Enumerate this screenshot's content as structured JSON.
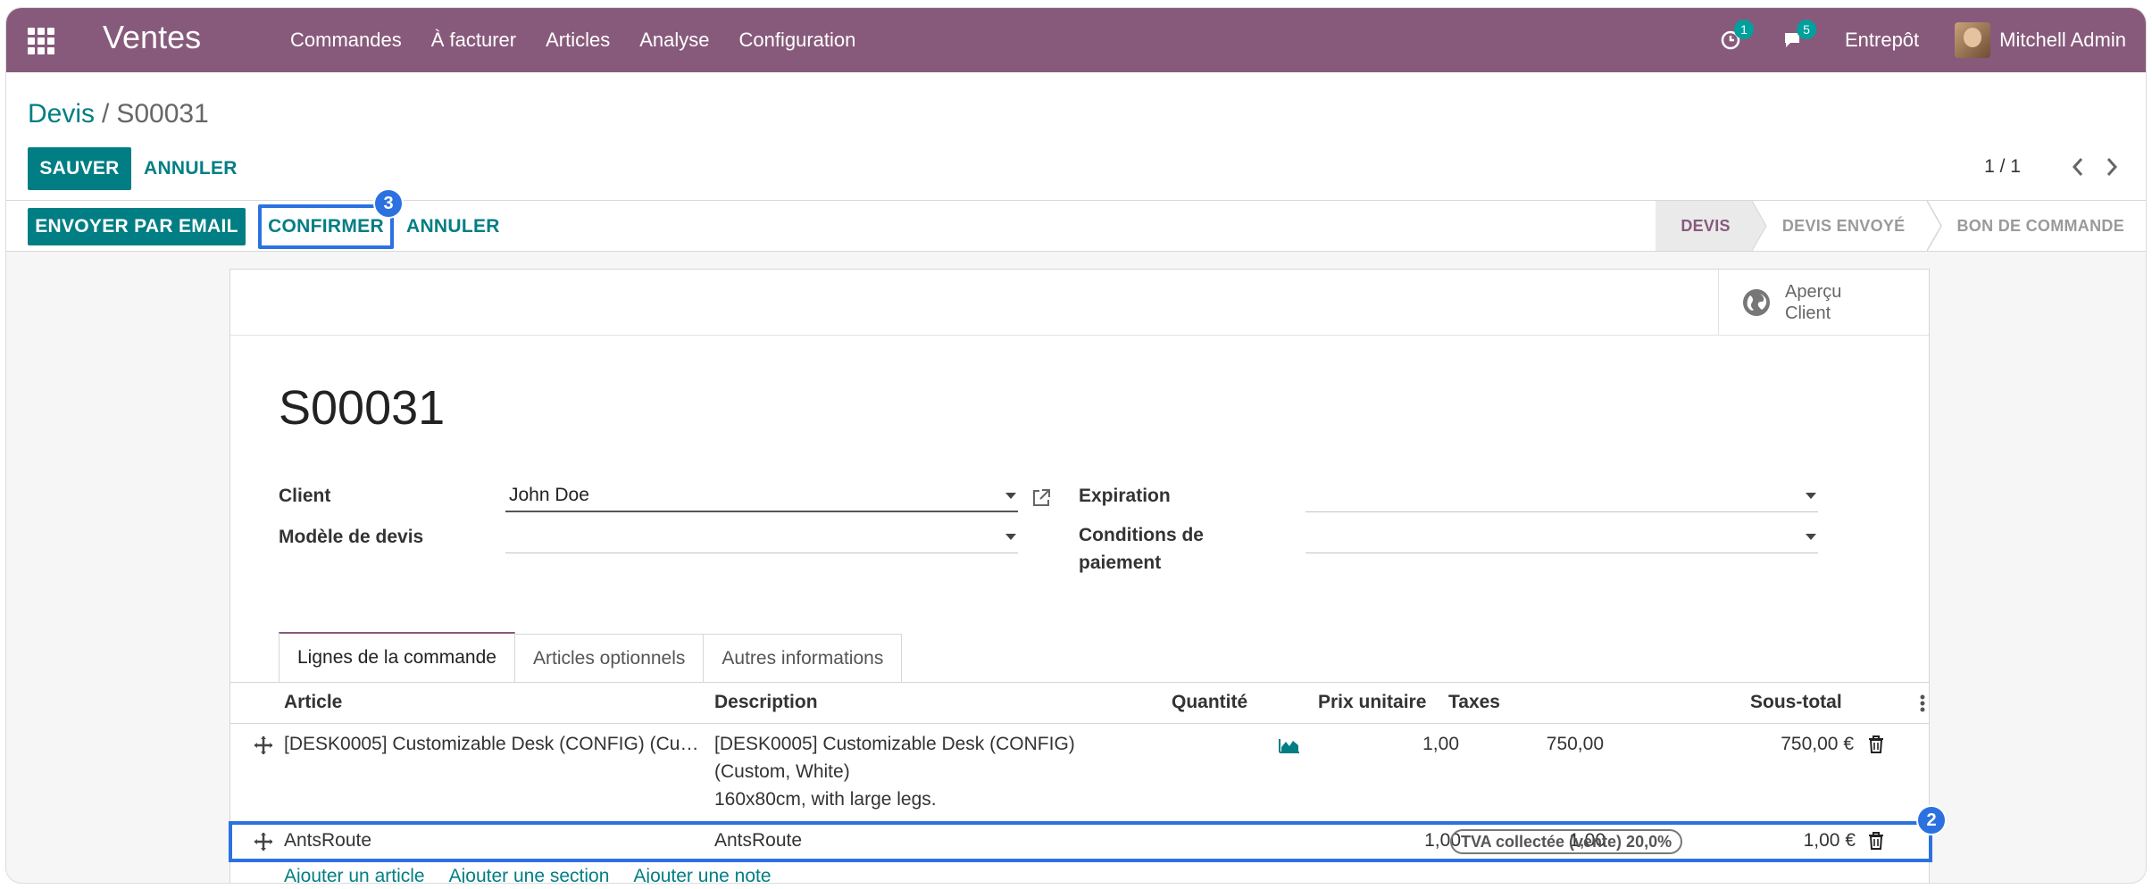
{
  "nav": {
    "app_name": "Ventes",
    "menu": [
      "Commandes",
      "À facturer",
      "Articles",
      "Analyse",
      "Configuration"
    ],
    "activity_count": "1",
    "messages_count": "5",
    "company": "Entrepôt",
    "user": "Mitchell Admin",
    "accent_color": "#875A7B"
  },
  "control_panel": {
    "breadcrumb_parent": "Devis",
    "breadcrumb_separator": "/",
    "breadcrumb_current": "S00031",
    "save_label": "SAUVER",
    "discard_label": "ANNULER",
    "pager_value": "1 / 1"
  },
  "statusbar": {
    "send_email_label": "ENVOYER PAR EMAIL",
    "confirm_label": "CONFIRMER",
    "cancel_label": "ANNULER",
    "confirm_step": "3",
    "stages": [
      "DEVIS",
      "DEVIS ENVOYÉ",
      "BON DE COMMANDE"
    ],
    "active_stage": "DEVIS"
  },
  "sheet": {
    "preview_label_line1": "Aperçu",
    "preview_label_line2": "Client",
    "title": "S00031",
    "fields": {
      "client_label": "Client",
      "client_value": "John Doe",
      "template_label": "Modèle de devis",
      "template_value": "",
      "expiration_label": "Expiration",
      "expiration_value": "",
      "payment_terms_label_line1": "Conditions de",
      "payment_terms_label_line2": "paiement",
      "payment_terms_value": ""
    },
    "tabs": [
      "Lignes de la commande",
      "Articles optionnels",
      "Autres informations"
    ],
    "table": {
      "headers": [
        "Article",
        "Description",
        "Quantité",
        "Prix unitaire",
        "Taxes",
        "Sous-total"
      ],
      "rows": [
        {
          "article": "[DESK0005] Customizable Desk (CONFIG) (Cu…",
          "description": [
            "[DESK0005] Customizable Desk (CONFIG)",
            "(Custom, White)",
            "160x80cm, with large legs."
          ],
          "quantity": "1,00",
          "unit_price": "750,00",
          "taxes": "",
          "subtotal": "750,00 €"
        },
        {
          "article": "AntsRoute",
          "description": [
            "AntsRoute"
          ],
          "quantity": "1,00",
          "unit_price": "1,00",
          "taxes": "TVA collectée (vente) 20,0%",
          "subtotal": "1,00 €"
        }
      ],
      "highlight_step": "2"
    },
    "add_links": [
      "Ajouter un article",
      "Ajouter une section",
      "Ajouter une note"
    ]
  }
}
